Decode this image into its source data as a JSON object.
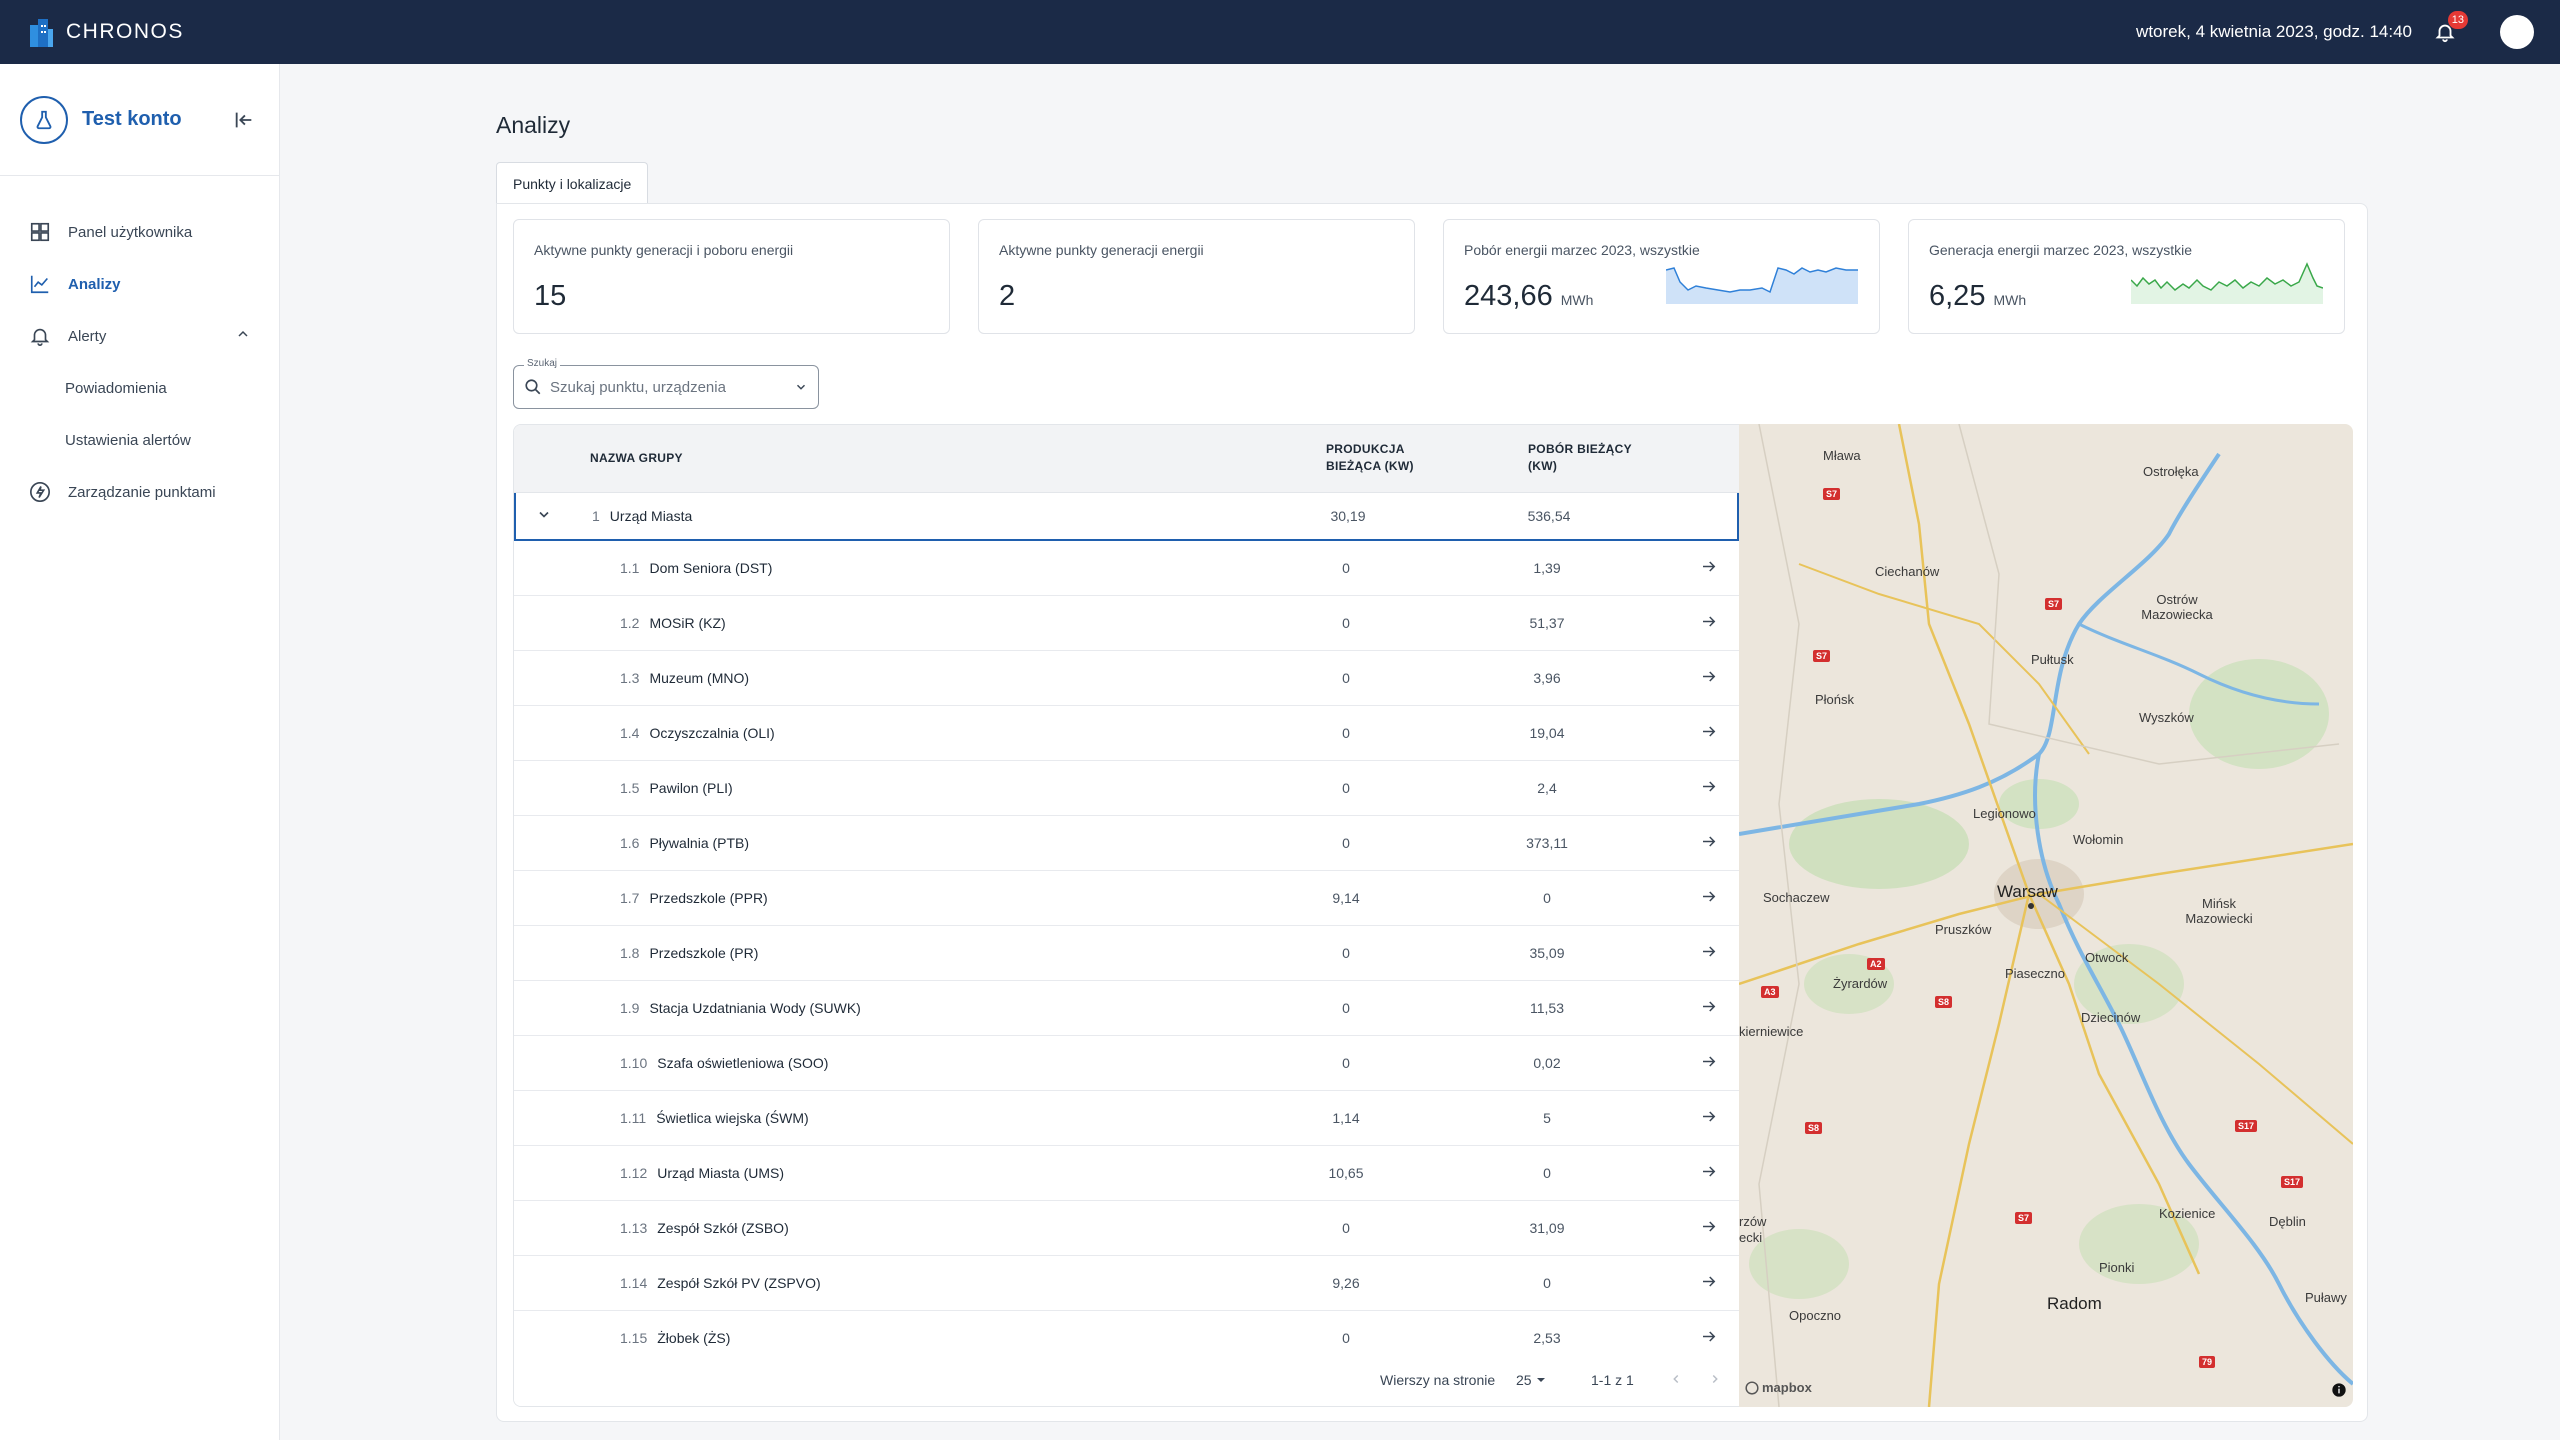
{
  "app": {
    "name": "CHRONOS",
    "datetime": "wtorek, 4 kwietnia 2023, godz. 14:40",
    "notifications": "13"
  },
  "sidebar": {
    "account": "Test konto",
    "items": [
      {
        "label": "Panel użytkownika",
        "icon": "dashboard-icon"
      },
      {
        "label": "Analizy",
        "icon": "chart-line-icon"
      },
      {
        "label": "Alerty",
        "icon": "bell-icon"
      },
      {
        "label": "Powiadomienia"
      },
      {
        "label": "Ustawienia alertów"
      },
      {
        "label": "Zarządzanie punktami",
        "icon": "bolt-icon"
      }
    ]
  },
  "page": {
    "title": "Analizy",
    "tab": "Punkty i lokalizacje"
  },
  "kpis": [
    {
      "label": "Aktywne punkty generacji i poboru energii",
      "value": "15",
      "unit": ""
    },
    {
      "label": "Aktywne punkty generacji energii",
      "value": "2",
      "unit": ""
    },
    {
      "label": "Pobór energii marzec 2023, wszystkie",
      "value": "243,66",
      "unit": "MWh"
    },
    {
      "label": "Generacja energii marzec 2023, wszystkie",
      "value": "6,25",
      "unit": "MWh"
    }
  ],
  "search": {
    "legend": "Szukaj",
    "placeholder": "Szukaj punktu, urządzenia"
  },
  "table": {
    "headers": {
      "group": "NAZWA GRUPY",
      "prod_1": "PRODUKCJA",
      "prod_2": "BIEŻĄCA (KW)",
      "pob_1": "POBÓR BIEŻĄCY",
      "pob_2": "(KW)"
    },
    "group": {
      "num": "1",
      "name": "Urząd Miasta",
      "prod": "30,19",
      "pob": "536,54"
    },
    "rows": [
      {
        "num": "1.1",
        "name": "Dom Seniora (DST)",
        "prod": "0",
        "pob": "1,39"
      },
      {
        "num": "1.2",
        "name": "MOSiR (KZ)",
        "prod": "0",
        "pob": "51,37"
      },
      {
        "num": "1.3",
        "name": "Muzeum (MNO)",
        "prod": "0",
        "pob": "3,96"
      },
      {
        "num": "1.4",
        "name": "Oczyszczalnia (OLI)",
        "prod": "0",
        "pob": "19,04"
      },
      {
        "num": "1.5",
        "name": "Pawilon (PLI)",
        "prod": "0",
        "pob": "2,4"
      },
      {
        "num": "1.6",
        "name": "Pływalnia (PTB)",
        "prod": "0",
        "pob": "373,11"
      },
      {
        "num": "1.7",
        "name": "Przedszkole (PPR)",
        "prod": "9,14",
        "pob": "0"
      },
      {
        "num": "1.8",
        "name": "Przedszkole (PR)",
        "prod": "0",
        "pob": "35,09"
      },
      {
        "num": "1.9",
        "name": "Stacja Uzdatniania Wody (SUWK)",
        "prod": "0",
        "pob": "11,53"
      },
      {
        "num": "1.10",
        "name": "Szafa oświetleniowa (SOO)",
        "prod": "0",
        "pob": "0,02"
      },
      {
        "num": "1.11",
        "name": "Świetlica wiejska (ŚWM)",
        "prod": "1,14",
        "pob": "5"
      },
      {
        "num": "1.12",
        "name": "Urząd Miasta (UMS)",
        "prod": "10,65",
        "pob": "0"
      },
      {
        "num": "1.13",
        "name": "Zespół Szkół (ZSBO)",
        "prod": "0",
        "pob": "31,09"
      },
      {
        "num": "1.14",
        "name": "Zespół Szkół PV (ZSPVO)",
        "prod": "9,26",
        "pob": "0"
      },
      {
        "num": "1.15",
        "name": "Żłobek (ŻS)",
        "prod": "0",
        "pob": "2,53"
      }
    ]
  },
  "pagination": {
    "rows_label": "Wierszy na stronie",
    "rows_value": "25",
    "range": "1-1 z 1"
  },
  "map": {
    "labels": [
      "Mława",
      "Ostrołęka",
      "Ciechanów",
      "Ostrów Mazowiecka",
      "Pułtusk",
      "Płońsk",
      "Wyszków",
      "Legionowo",
      "Wołomin",
      "Sochaczew",
      "Warsaw",
      "Mińsk Mazowiecki",
      "Pruszków",
      "Otwock",
      "Piaseczno",
      "Żyrardów",
      "Dziecinów",
      "kierniewice",
      "Kozienice",
      "Dęblin",
      "Pionki",
      "Radom",
      "Opoczno",
      "Puławy",
      "rzów",
      "ecki"
    ],
    "attribution": "mapbox"
  },
  "colors": {
    "primary": "#1f5fae",
    "topbar": "#1b2a47",
    "spark_blue": "#2f80d8",
    "spark_green": "#3aa84a"
  }
}
